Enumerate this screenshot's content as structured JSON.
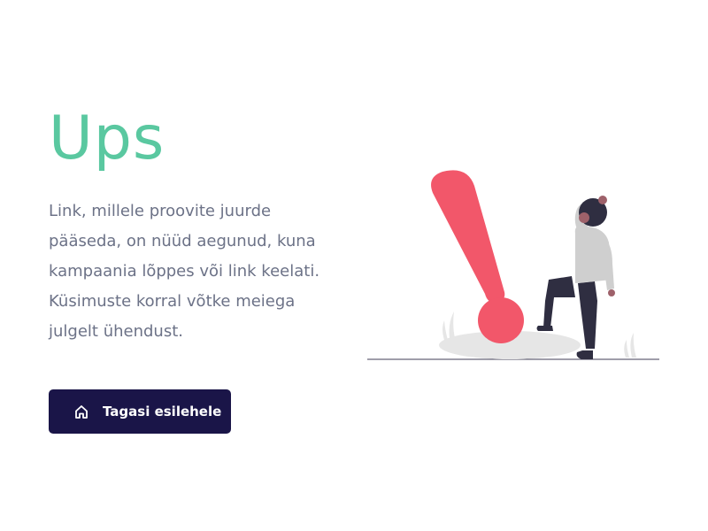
{
  "heading": "Ups",
  "message": "Link, millele proovite juurde pääseda, on nüüd aegunud, kuna kampaania lõppes või link keelati. Küsimuste korral võtke meiega julgelt ühendust.",
  "back_button": {
    "label": "Tagasi esilehele",
    "icon": "home-icon"
  },
  "colors": {
    "heading": "#5ac8a0",
    "button_bg": "#1a1548",
    "exclamation": "#f2576a"
  }
}
